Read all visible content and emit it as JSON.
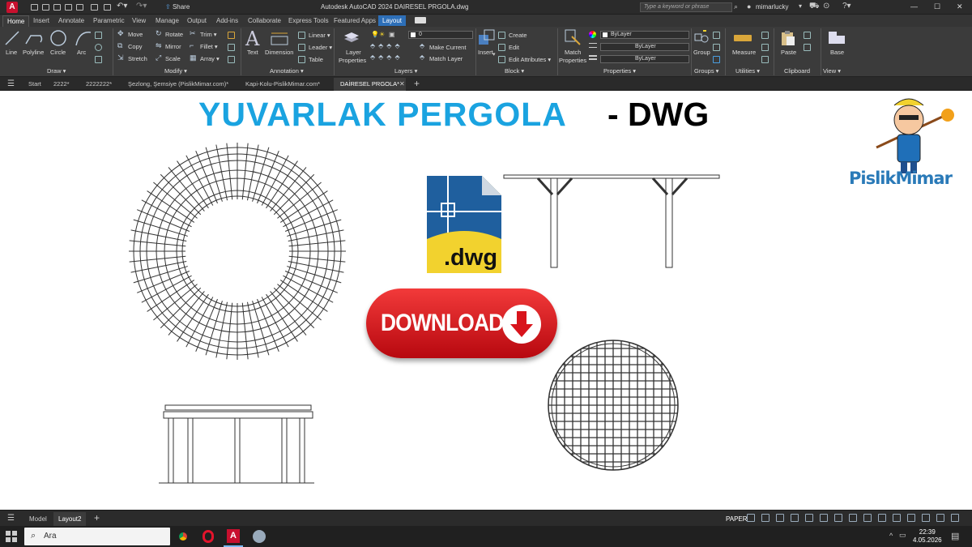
{
  "window": {
    "logo_letter": "A",
    "share_label": "Share",
    "title": "Autodesk AutoCAD 2024   DAIRESEL PRGOLA.dwg",
    "search_placeholder": "Type a keyword or phrase",
    "user": "mimarlucky",
    "min": "—",
    "max": "☐",
    "close": "✕"
  },
  "ribbon_tabs": [
    "Home",
    "Insert",
    "Annotate",
    "Parametric",
    "View",
    "Manage",
    "Output",
    "Add-ins",
    "Collaborate",
    "Express Tools",
    "Featured Apps",
    "Layout"
  ],
  "ribbon": {
    "draw": {
      "line": "Line",
      "polyline": "Polyline",
      "circle": "Circle",
      "arc": "Arc",
      "title": "Draw ▾"
    },
    "modify": {
      "move": "Move",
      "rotate": "Rotate",
      "trim": "Trim ▾",
      "copy": "Copy",
      "mirror": "Mirror",
      "fillet": "Fillet ▾",
      "stretch": "Stretch",
      "scale": "Scale",
      "array": "Array ▾",
      "title": "Modify ▾"
    },
    "annotation": {
      "text": "Text",
      "dimension": "Dimension",
      "linear": "Linear ▾",
      "leader": "Leader ▾",
      "table": "Table",
      "title": "Annotation ▾"
    },
    "layers": {
      "layer_properties_1": "Layer",
      "layer_properties_2": "Properties",
      "layer_combo": "0",
      "make_current": "Make Current",
      "match_layer": "Match Layer",
      "title": "Layers ▾"
    },
    "block": {
      "insert": "Insert",
      "create": "Create",
      "edit": "Edit",
      "edit_attributes": "Edit Attributes ▾",
      "title": "Block ▾"
    },
    "properties": {
      "match_1": "Match",
      "match_2": "Properties",
      "bylayer_color": "ByLayer",
      "bylayer_linetype": "ByLayer",
      "bylayer_lineweight": "ByLayer",
      "title": "Properties ▾"
    },
    "groups": {
      "group": "Group",
      "title": "Groups ▾"
    },
    "utilities": {
      "measure": "Measure",
      "title": "Utilities ▾"
    },
    "clipboard": {
      "paste": "Paste",
      "title": "Clipboard"
    },
    "view": {
      "base": "Base",
      "title": "View ▾"
    }
  },
  "doc_tabs": [
    "Start",
    "2222*",
    "2222222*",
    "Şezlong, Şemsiye (PislikMimar.com)*",
    "Kapi-Kolu-PislikMimar.com*",
    "DAİRESEL PRGOLA*"
  ],
  "canvas": {
    "title_main": "YUVARLAK PERGOLA",
    "title_suffix": "- DWG",
    "dwg_label": ".dwg",
    "download_label": "DOWNLOAD",
    "brand": "PislikMimar"
  },
  "layout_tabs": [
    "Model",
    "Layout2"
  ],
  "status": {
    "paper": "PAPER"
  },
  "taskbar": {
    "search": "Ara",
    "time": "22:39",
    "date": "4.05.2026"
  },
  "colors": {
    "title_blue": "#1aa3e0",
    "layout_tab_blue": "#2d6fb8",
    "download_red": "#d8141c",
    "dwg_yellow": "#f2d22e",
    "dwg_blue": "#1f5f9e"
  }
}
